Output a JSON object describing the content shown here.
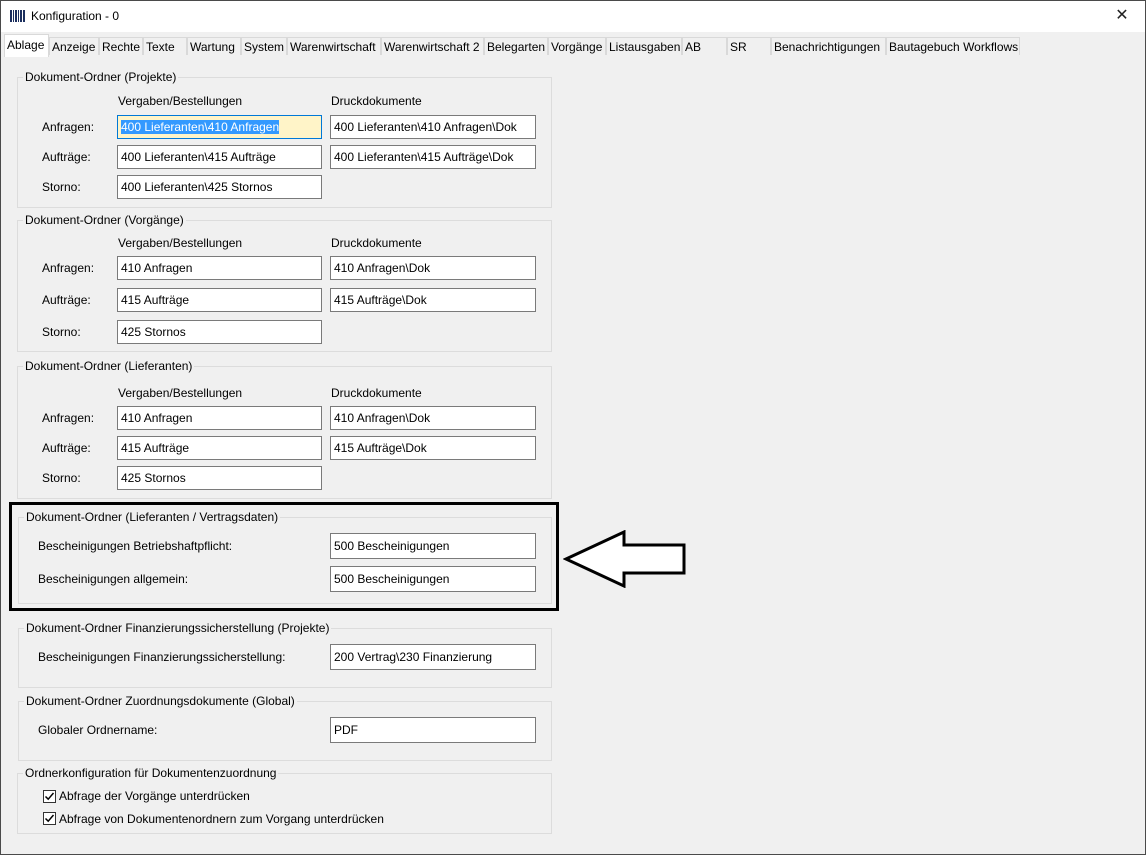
{
  "window": {
    "title": "Konfiguration - 0"
  },
  "tabs": [
    {
      "label": "Ablage"
    },
    {
      "label": "Anzeige"
    },
    {
      "label": "Rechte"
    },
    {
      "label": "Texte"
    },
    {
      "label": "Wartung"
    },
    {
      "label": "System"
    },
    {
      "label": "Warenwirtschaft"
    },
    {
      "label": "Warenwirtschaft 2"
    },
    {
      "label": "Belegarten"
    },
    {
      "label": "Vorgänge"
    },
    {
      "label": "Listausgaben"
    },
    {
      "label": "AB"
    },
    {
      "label": "SR"
    },
    {
      "label": "Benachrichtigungen"
    },
    {
      "label": "Bautagebuch Workflows"
    }
  ],
  "groups": {
    "projekte": {
      "legend": "Dokument-Ordner (Projekte)",
      "col1": "Vergaben/Bestellungen",
      "col2": "Druckdokumente",
      "anfragen_label": "Anfragen:",
      "auftraege_label": "Aufträge:",
      "storno_label": "Storno:",
      "anfragen_vb": "400 Lieferanten\\410 Anfragen",
      "anfragen_dd": "400 Lieferanten\\410 Anfragen\\Dok",
      "auftraege_vb": "400 Lieferanten\\415 Aufträge",
      "auftraege_dd": "400 Lieferanten\\415 Aufträge\\Dok",
      "storno_vb": "400 Lieferanten\\425 Stornos"
    },
    "vorgaenge": {
      "legend": "Dokument-Ordner (Vorgänge)",
      "col1": "Vergaben/Bestellungen",
      "col2": "Druckdokumente",
      "anfragen_label": "Anfragen:",
      "auftraege_label": "Aufträge:",
      "storno_label": "Storno:",
      "anfragen_vb": "410 Anfragen",
      "anfragen_dd": "410 Anfragen\\Dok",
      "auftraege_vb": "415 Aufträge",
      "auftraege_dd": "415 Aufträge\\Dok",
      "storno_vb": "425 Stornos"
    },
    "lieferanten": {
      "legend": "Dokument-Ordner (Lieferanten)",
      "col1": "Vergaben/Bestellungen",
      "col2": "Druckdokumente",
      "anfragen_label": "Anfragen:",
      "auftraege_label": "Aufträge:",
      "storno_label": "Storno:",
      "anfragen_vb": "410 Anfragen",
      "anfragen_dd": "410 Anfragen\\Dok",
      "auftraege_vb": "415 Aufträge",
      "auftraege_dd": "415 Aufträge\\Dok",
      "storno_vb": "425 Stornos"
    },
    "vertragsdaten": {
      "legend": "Dokument-Ordner (Lieferanten / Vertragsdaten)",
      "betrieb_label": "Bescheinigungen Betriebshaftpflicht:",
      "betrieb_value": "500 Bescheinigungen",
      "allgemein_label": "Bescheinigungen allgemein:",
      "allgemein_value": "500 Bescheinigungen"
    },
    "finanzierung": {
      "legend": "Dokument-Ordner Finanzierungssicherstellung (Projekte)",
      "label": "Bescheinigungen Finanzierungssicherstellung:",
      "value": "200 Vertrag\\230 Finanzierung"
    },
    "zuordnung": {
      "legend": "Dokument-Ordner Zuordnungsdokumente (Global)",
      "label": "Globaler Ordnername:",
      "value": "PDF"
    },
    "ordnerkonfig": {
      "legend": "Ordnerkonfiguration für Dokumentenzuordnung",
      "check1_label": "Abfrage der Vorgänge unterdrücken",
      "check1_checked": true,
      "check2_label": "Abfrage von Dokumentenordnern zum Vorgang unterdrücken",
      "check2_checked": true
    }
  },
  "icons": {
    "app": "barcode-icon",
    "close": "close-icon",
    "check": "checkmark-icon",
    "arrow": "left-arrow-icon"
  },
  "colors": {
    "highlight_border": "#000000",
    "focus_bg": "#fff4c8",
    "selection": "#3399ff"
  }
}
